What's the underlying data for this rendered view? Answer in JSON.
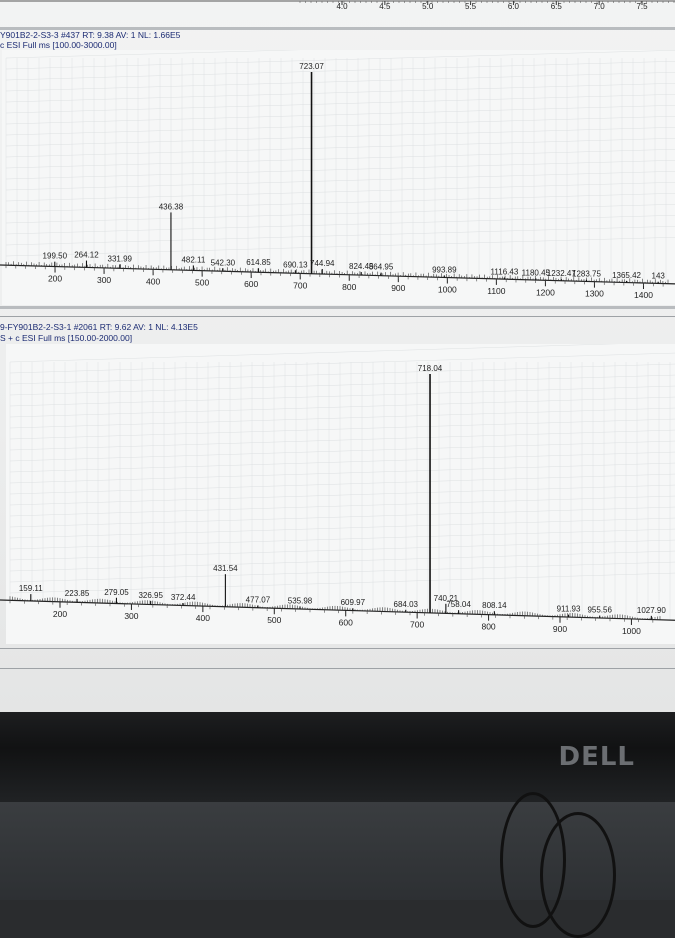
{
  "top_axis": {
    "ticks": [
      "4.0",
      "4.5",
      "5.0",
      "5.5",
      "6.0",
      "6.5",
      "7.0",
      "7.5"
    ],
    "values": [
      4.0,
      4.5,
      5.0,
      5.5,
      6.0,
      6.5,
      7.0,
      7.5
    ]
  },
  "panel1": {
    "header_line1": "Y901B2-2-S3-3 #437  RT: 9.38  AV: 1  NL: 1.66E5",
    "header_line2": "c ESI Full ms [100.00-3000.00]"
  },
  "panel2": {
    "header_line1": "9-FY901B2-2-S3-1 #2061  RT: 9.62  AV: 1  NL: 4.13E5",
    "header_line2": "S + c ESI Full ms [150.00-2000.00]"
  },
  "brand": "DELL",
  "chart_data": [
    {
      "type": "bar",
      "title": "Y901B2-2-S3-3 #437  RT: 9.38  AV: 1  NL: 1.66E5",
      "subtitle": "c ESI Full ms [100.00-3000.00]",
      "xlim": [
        100,
        1450
      ],
      "ylim": [
        0,
        100
      ],
      "xticks": [
        200,
        300,
        400,
        500,
        600,
        700,
        800,
        900,
        1000,
        1100,
        1200,
        1300,
        1400
      ],
      "peaks": [
        {
          "mz": 199.5,
          "intensity": 2.5,
          "label": "199.50"
        },
        {
          "mz": 264.12,
          "intensity": 3.5,
          "label": "264.12"
        },
        {
          "mz": 331.99,
          "intensity": 2.0,
          "label": "331.99"
        },
        {
          "mz": 436.38,
          "intensity": 29,
          "label": "436.38"
        },
        {
          "mz": 482.11,
          "intensity": 2.5,
          "label": "482.11"
        },
        {
          "mz": 542.3,
          "intensity": 1.5,
          "label": "542.30"
        },
        {
          "mz": 614.85,
          "intensity": 2.0,
          "label": "614.85"
        },
        {
          "mz": 690.13,
          "intensity": 1.5,
          "label": "690.13"
        },
        {
          "mz": 723.07,
          "intensity": 100,
          "label": "723.07"
        },
        {
          "mz": 744.94,
          "intensity": 2.5,
          "label": "744.94"
        },
        {
          "mz": 824.45,
          "intensity": 1.5,
          "label": "824.45"
        },
        {
          "mz": 864.95,
          "intensity": 1.5,
          "label": "864.95"
        },
        {
          "mz": 993.89,
          "intensity": 1.0,
          "label": "993.89"
        },
        {
          "mz": 1116.43,
          "intensity": 0.8,
          "label": "1116.43"
        },
        {
          "mz": 1180.45,
          "intensity": 0.8,
          "label": "1180.45"
        },
        {
          "mz": 1232.47,
          "intensity": 0.8,
          "label": "1232.47"
        },
        {
          "mz": 1283.75,
          "intensity": 0.8,
          "label": "1283.75"
        },
        {
          "mz": 1365.42,
          "intensity": 0.8,
          "label": "1365.42"
        },
        {
          "mz": 1430,
          "intensity": 0.8,
          "label": "143"
        }
      ]
    },
    {
      "type": "bar",
      "title": "9-FY901B2-2-S3-1 #2061  RT: 9.62  AV: 1  NL: 4.13E5",
      "subtitle": "S + c ESI Full ms [150.00-2000.00]",
      "xlim": [
        130,
        1040
      ],
      "ylim": [
        0,
        100
      ],
      "xticks": [
        200,
        300,
        400,
        500,
        600,
        700,
        800,
        900,
        1000
      ],
      "peaks": [
        {
          "mz": 159.11,
          "intensity": 3,
          "label": "159.11"
        },
        {
          "mz": 223.85,
          "intensity": 1.5,
          "label": "223.85"
        },
        {
          "mz": 279.05,
          "intensity": 2.5,
          "label": "279.05"
        },
        {
          "mz": 326.95,
          "intensity": 1.5,
          "label": "326.95"
        },
        {
          "mz": 372.44,
          "intensity": 1.0,
          "label": "372.44"
        },
        {
          "mz": 431.54,
          "intensity": 14,
          "label": "431.54"
        },
        {
          "mz": 477.07,
          "intensity": 1.0,
          "label": "477.07"
        },
        {
          "mz": 535.98,
          "intensity": 1.0,
          "label": "535.98"
        },
        {
          "mz": 609.97,
          "intensity": 1.0,
          "label": "609.97"
        },
        {
          "mz": 684.03,
          "intensity": 1.0,
          "label": "684.03"
        },
        {
          "mz": 718.04,
          "intensity": 100,
          "label": "718.04"
        },
        {
          "mz": 740.21,
          "intensity": 4,
          "label": "740.21"
        },
        {
          "mz": 758.04,
          "intensity": 1.5,
          "label": "758.04"
        },
        {
          "mz": 808.14,
          "intensity": 1.5,
          "label": "808.14"
        },
        {
          "mz": 911.93,
          "intensity": 1.0,
          "label": "911.93"
        },
        {
          "mz": 955.56,
          "intensity": 1.0,
          "label": "955.56"
        },
        {
          "mz": 1027.9,
          "intensity": 1.5,
          "label": "1027.90"
        }
      ]
    }
  ]
}
